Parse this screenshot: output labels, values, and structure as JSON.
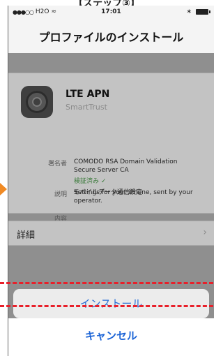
{
  "caption": "【ステップ③】",
  "status": {
    "carrier": "H2O",
    "time": "17:01",
    "bluetooth": "∗"
  },
  "nav": {
    "title": "プロファイルのインストール"
  },
  "profile": {
    "name": "LTE APN",
    "org": "SmartTrust",
    "signer_label": "署名者",
    "signer_value_1": "COMODO RSA Domain Validation",
    "signer_value_2": "Secure Server CA",
    "verified": "検証済み ✓",
    "desc_label": "説明",
    "desc_value_1": "Settings for your iPhone, sent by your",
    "desc_value_2": "operator.",
    "content_label": "内容",
    "content_value": "モバイルデータ通信設定"
  },
  "details": {
    "label": "詳細",
    "chevron": "›"
  },
  "sheet": {
    "install": "インストール",
    "cancel": "キャンセル"
  },
  "colors": {
    "accent": "#2a6fd6",
    "highlight": "#e8202a",
    "arrow": "#f08a24"
  }
}
